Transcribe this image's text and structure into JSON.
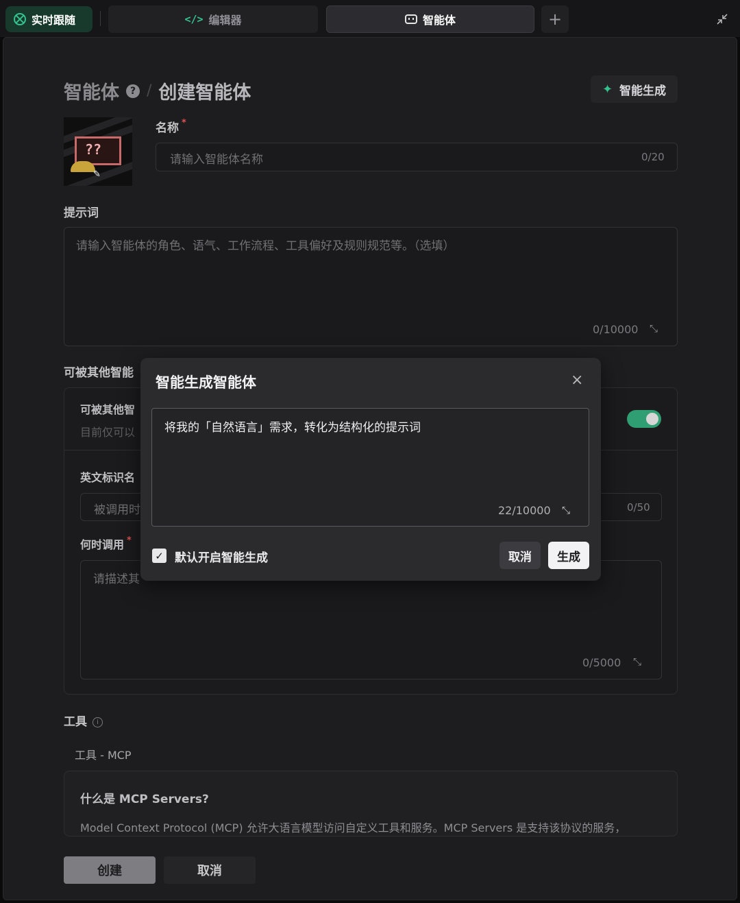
{
  "tabs": {
    "live_label": "实时跟随",
    "editor_label": "编辑器",
    "editor_icon": "code-icon",
    "agent_label": "智能体",
    "agent_icon": "bot-icon",
    "add_label": "+",
    "collapse_icon": "collapse-icon"
  },
  "header": {
    "crumb_root": "智能体",
    "crumb_sep": "/",
    "crumb_current": "创建智能体",
    "help": "?",
    "ai_generate_label": "智能生成"
  },
  "avatar": {
    "glyph": "??"
  },
  "name_field": {
    "label": "名称",
    "required": "*",
    "placeholder": "请输入智能体名称",
    "counter": "0/20"
  },
  "prompt_field": {
    "label": "提示词",
    "placeholder": "请输入智能体的角色、语气、工作流程、工具偏好及规则规范等。（选填）",
    "counter": "0/10000"
  },
  "callable_section": {
    "title": "可被其他智能",
    "row_title": "可被其他智",
    "row_desc": "目前仅可以",
    "toggle_on": true,
    "en_name_label": "英文标识名",
    "en_name_placeholder": "被调用时",
    "en_name_counter": "0/50",
    "when_label": "何时调用",
    "when_required": "*",
    "when_placeholder": "请描述其",
    "when_counter": "0/5000"
  },
  "tools": {
    "label": "工具",
    "mcp_label": "工具 - MCP",
    "mcp_title": "什么是 MCP Servers?",
    "mcp_desc": "Model Context Protocol (MCP) 允许大语言模型访问自定义工具和服务。MCP Servers 是支持该协议的服务，"
  },
  "footer": {
    "create_label": "创建",
    "cancel_label": "取消"
  },
  "modal": {
    "title": "智能生成智能体",
    "close": "×",
    "text": "将我的「自然语言」需求，转化为结构化的提示词",
    "counter": "22/10000",
    "checkbox_checked": true,
    "checkbox_label": "默认开启智能生成",
    "cancel_label": "取消",
    "generate_label": "生成"
  },
  "colors": {
    "accent": "#34c38f",
    "toggle": "#2f9e73",
    "required": "#e0524f"
  }
}
